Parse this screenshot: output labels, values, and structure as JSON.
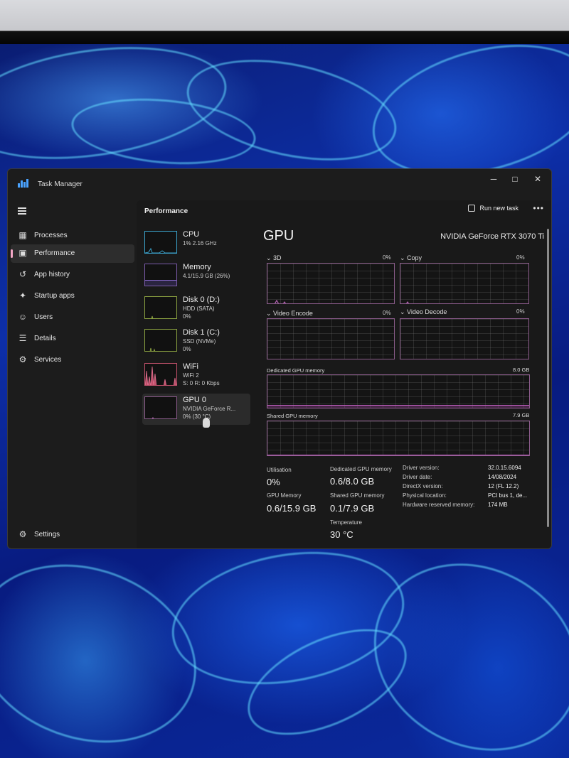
{
  "window": {
    "title": "Task Manager",
    "controls": {
      "minimize": "─",
      "maximize": "□",
      "close": "✕"
    }
  },
  "sidebar": {
    "items": [
      {
        "label": "Processes",
        "icon": "processes-icon",
        "glyph": "▦"
      },
      {
        "label": "Performance",
        "icon": "performance-icon",
        "glyph": "▣"
      },
      {
        "label": "App history",
        "icon": "app-history-icon",
        "glyph": "↺"
      },
      {
        "label": "Startup apps",
        "icon": "startup-apps-icon",
        "glyph": "✦"
      },
      {
        "label": "Users",
        "icon": "users-icon",
        "glyph": "☺"
      },
      {
        "label": "Details",
        "icon": "details-icon",
        "glyph": "☰"
      },
      {
        "label": "Services",
        "icon": "services-icon",
        "glyph": "⚙"
      }
    ],
    "settings": {
      "label": "Settings",
      "glyph": "⚙"
    }
  },
  "header": {
    "title": "Performance",
    "run_new_task": "Run new task",
    "more": "•••"
  },
  "devices": [
    {
      "name": "CPU",
      "lines": [
        "1% 2.16 GHz"
      ]
    },
    {
      "name": "Memory",
      "lines": [
        "4.1/15.9 GB (26%)"
      ]
    },
    {
      "name": "Disk 0 (D:)",
      "lines": [
        "HDD (SATA)",
        "0%"
      ]
    },
    {
      "name": "Disk 1 (C:)",
      "lines": [
        "SSD (NVMe)",
        "0%"
      ]
    },
    {
      "name": "WiFi",
      "lines": [
        "WiFi 2",
        "S: 0 R: 0 Kbps"
      ]
    },
    {
      "name": "GPU 0",
      "lines": [
        "NVIDIA GeForce R...",
        "0% (30 °C)"
      ]
    }
  ],
  "gpu": {
    "title": "GPU",
    "model": "NVIDIA GeForce RTX 3070 Ti",
    "engines": [
      {
        "label": "3D",
        "percent": "0%"
      },
      {
        "label": "Copy",
        "percent": "0%"
      },
      {
        "label": "Video Encode",
        "percent": "0%"
      },
      {
        "label": "Video Decode",
        "percent": "0%"
      }
    ],
    "dedicated_memory": {
      "label": "Dedicated GPU memory",
      "max": "8.0 GB"
    },
    "shared_memory": {
      "label": "Shared GPU memory",
      "max": "7.9 GB"
    },
    "stats": {
      "utilisation": {
        "label": "Utilisation",
        "value": "0%"
      },
      "dedicated": {
        "label": "Dedicated GPU memory",
        "value": "0.6/8.0 GB"
      },
      "gpu_memory": {
        "label": "GPU Memory",
        "value": "0.6/15.9 GB"
      },
      "shared": {
        "label": "Shared GPU memory",
        "value": "0.1/7.9 GB"
      },
      "temperature": {
        "label": "Temperature",
        "value": "30 °C"
      }
    },
    "info": [
      {
        "key": "Driver version:",
        "value": "32.0.15.6094"
      },
      {
        "key": "Driver date:",
        "value": "14/08/2024"
      },
      {
        "key": "DirectX version:",
        "value": "12 (FL 12.2)"
      },
      {
        "key": "Physical location:",
        "value": "PCI bus 1, de..."
      },
      {
        "key": "Hardware reserved memory:",
        "value": "174 MB"
      }
    ]
  },
  "colors": {
    "accent": "#f4a7c6",
    "graph_border": "#8a5b8a",
    "thumb_border": "#3aa0c8"
  }
}
